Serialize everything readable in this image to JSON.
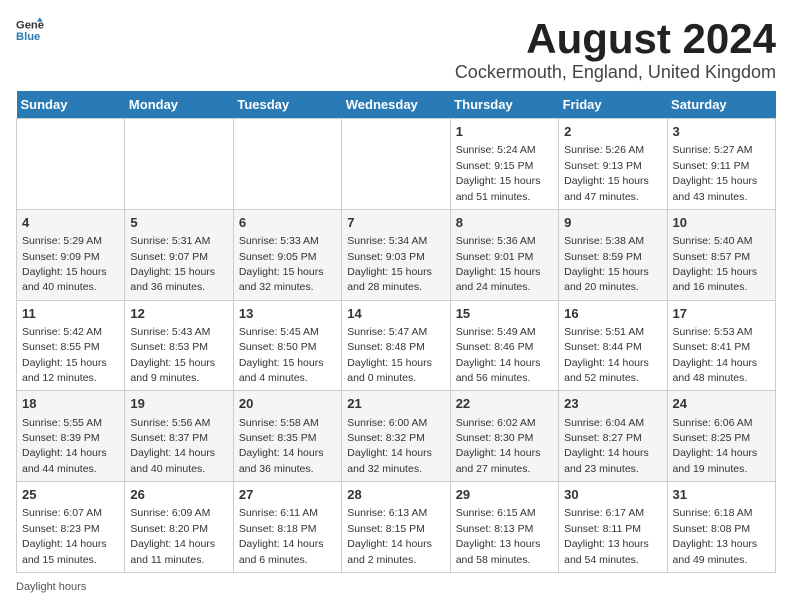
{
  "header": {
    "logo_general": "General",
    "logo_blue": "Blue",
    "title": "August 2024",
    "subtitle": "Cockermouth, England, United Kingdom"
  },
  "columns": [
    "Sunday",
    "Monday",
    "Tuesday",
    "Wednesday",
    "Thursday",
    "Friday",
    "Saturday"
  ],
  "weeks": [
    [
      {
        "day": "",
        "info": ""
      },
      {
        "day": "",
        "info": ""
      },
      {
        "day": "",
        "info": ""
      },
      {
        "day": "",
        "info": ""
      },
      {
        "day": "1",
        "info": "Sunrise: 5:24 AM\nSunset: 9:15 PM\nDaylight: 15 hours and 51 minutes."
      },
      {
        "day": "2",
        "info": "Sunrise: 5:26 AM\nSunset: 9:13 PM\nDaylight: 15 hours and 47 minutes."
      },
      {
        "day": "3",
        "info": "Sunrise: 5:27 AM\nSunset: 9:11 PM\nDaylight: 15 hours and 43 minutes."
      }
    ],
    [
      {
        "day": "4",
        "info": "Sunrise: 5:29 AM\nSunset: 9:09 PM\nDaylight: 15 hours and 40 minutes."
      },
      {
        "day": "5",
        "info": "Sunrise: 5:31 AM\nSunset: 9:07 PM\nDaylight: 15 hours and 36 minutes."
      },
      {
        "day": "6",
        "info": "Sunrise: 5:33 AM\nSunset: 9:05 PM\nDaylight: 15 hours and 32 minutes."
      },
      {
        "day": "7",
        "info": "Sunrise: 5:34 AM\nSunset: 9:03 PM\nDaylight: 15 hours and 28 minutes."
      },
      {
        "day": "8",
        "info": "Sunrise: 5:36 AM\nSunset: 9:01 PM\nDaylight: 15 hours and 24 minutes."
      },
      {
        "day": "9",
        "info": "Sunrise: 5:38 AM\nSunset: 8:59 PM\nDaylight: 15 hours and 20 minutes."
      },
      {
        "day": "10",
        "info": "Sunrise: 5:40 AM\nSunset: 8:57 PM\nDaylight: 15 hours and 16 minutes."
      }
    ],
    [
      {
        "day": "11",
        "info": "Sunrise: 5:42 AM\nSunset: 8:55 PM\nDaylight: 15 hours and 12 minutes."
      },
      {
        "day": "12",
        "info": "Sunrise: 5:43 AM\nSunset: 8:53 PM\nDaylight: 15 hours and 9 minutes."
      },
      {
        "day": "13",
        "info": "Sunrise: 5:45 AM\nSunset: 8:50 PM\nDaylight: 15 hours and 4 minutes."
      },
      {
        "day": "14",
        "info": "Sunrise: 5:47 AM\nSunset: 8:48 PM\nDaylight: 15 hours and 0 minutes."
      },
      {
        "day": "15",
        "info": "Sunrise: 5:49 AM\nSunset: 8:46 PM\nDaylight: 14 hours and 56 minutes."
      },
      {
        "day": "16",
        "info": "Sunrise: 5:51 AM\nSunset: 8:44 PM\nDaylight: 14 hours and 52 minutes."
      },
      {
        "day": "17",
        "info": "Sunrise: 5:53 AM\nSunset: 8:41 PM\nDaylight: 14 hours and 48 minutes."
      }
    ],
    [
      {
        "day": "18",
        "info": "Sunrise: 5:55 AM\nSunset: 8:39 PM\nDaylight: 14 hours and 44 minutes."
      },
      {
        "day": "19",
        "info": "Sunrise: 5:56 AM\nSunset: 8:37 PM\nDaylight: 14 hours and 40 minutes."
      },
      {
        "day": "20",
        "info": "Sunrise: 5:58 AM\nSunset: 8:35 PM\nDaylight: 14 hours and 36 minutes."
      },
      {
        "day": "21",
        "info": "Sunrise: 6:00 AM\nSunset: 8:32 PM\nDaylight: 14 hours and 32 minutes."
      },
      {
        "day": "22",
        "info": "Sunrise: 6:02 AM\nSunset: 8:30 PM\nDaylight: 14 hours and 27 minutes."
      },
      {
        "day": "23",
        "info": "Sunrise: 6:04 AM\nSunset: 8:27 PM\nDaylight: 14 hours and 23 minutes."
      },
      {
        "day": "24",
        "info": "Sunrise: 6:06 AM\nSunset: 8:25 PM\nDaylight: 14 hours and 19 minutes."
      }
    ],
    [
      {
        "day": "25",
        "info": "Sunrise: 6:07 AM\nSunset: 8:23 PM\nDaylight: 14 hours and 15 minutes."
      },
      {
        "day": "26",
        "info": "Sunrise: 6:09 AM\nSunset: 8:20 PM\nDaylight: 14 hours and 11 minutes."
      },
      {
        "day": "27",
        "info": "Sunrise: 6:11 AM\nSunset: 8:18 PM\nDaylight: 14 hours and 6 minutes."
      },
      {
        "day": "28",
        "info": "Sunrise: 6:13 AM\nSunset: 8:15 PM\nDaylight: 14 hours and 2 minutes."
      },
      {
        "day": "29",
        "info": "Sunrise: 6:15 AM\nSunset: 8:13 PM\nDaylight: 13 hours and 58 minutes."
      },
      {
        "day": "30",
        "info": "Sunrise: 6:17 AM\nSunset: 8:11 PM\nDaylight: 13 hours and 54 minutes."
      },
      {
        "day": "31",
        "info": "Sunrise: 6:18 AM\nSunset: 8:08 PM\nDaylight: 13 hours and 49 minutes."
      }
    ]
  ],
  "footer": {
    "daylight_label": "Daylight hours"
  }
}
